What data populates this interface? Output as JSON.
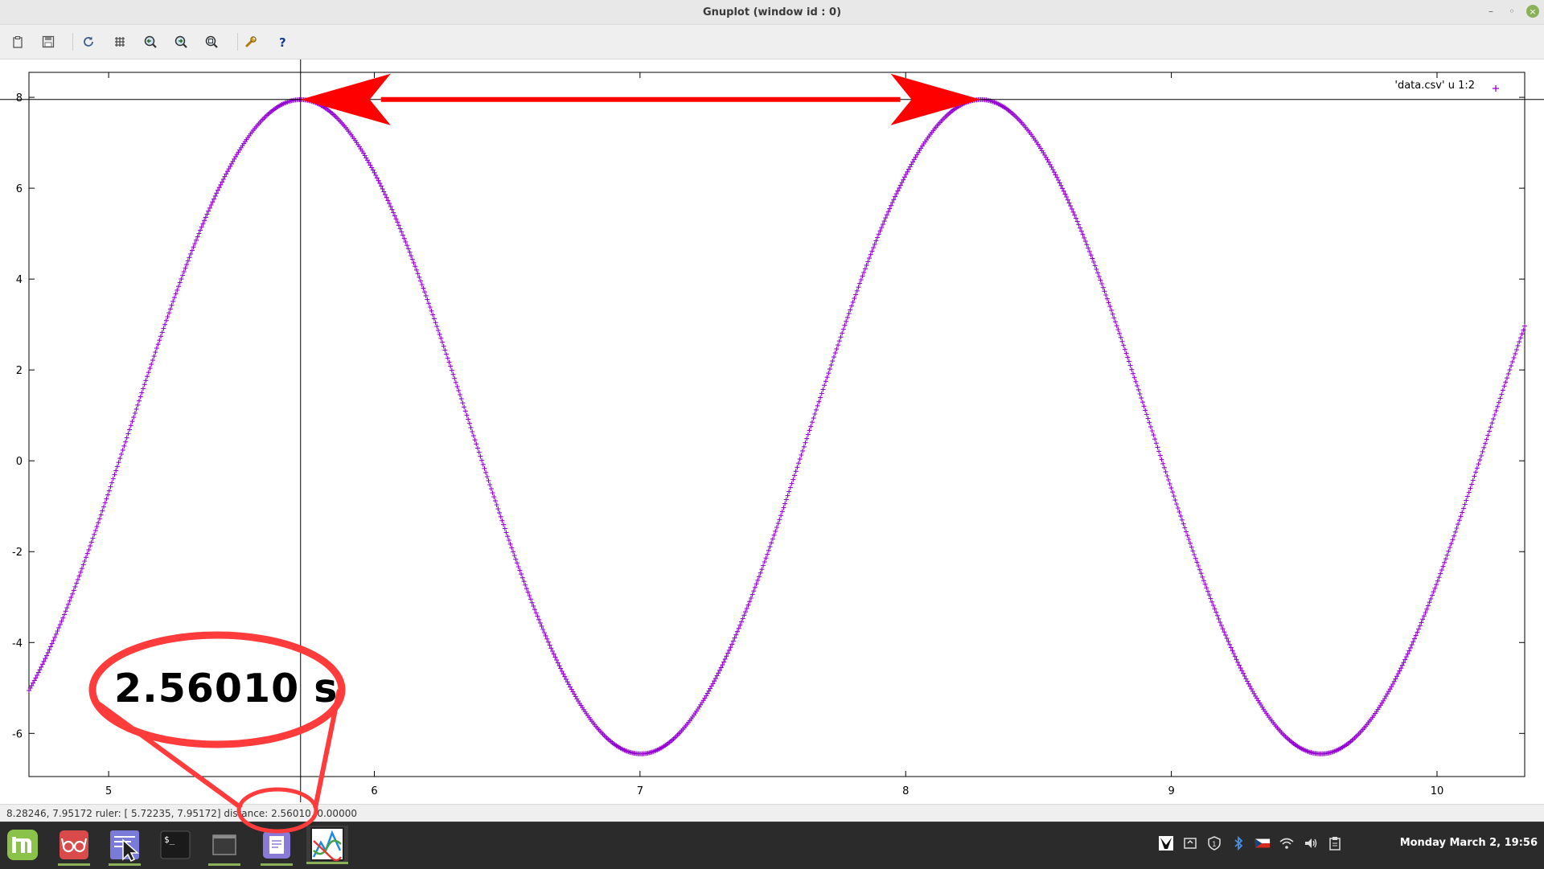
{
  "window": {
    "title": "Gnuplot (window id : 0)",
    "controls": [
      "minimize",
      "maximize",
      "close"
    ]
  },
  "toolbar": {
    "buttons": [
      {
        "name": "copy-clipboard",
        "icon": "clipboard-icon"
      },
      {
        "name": "export",
        "icon": "save-icon"
      },
      {
        "name": "replot",
        "icon": "refresh-icon"
      },
      {
        "name": "grid",
        "icon": "grid-icon"
      },
      {
        "name": "previous-zoom",
        "icon": "zoom-previous-icon"
      },
      {
        "name": "next-zoom",
        "icon": "zoom-next-icon"
      },
      {
        "name": "autoscale",
        "icon": "zoom-fit-icon"
      },
      {
        "name": "settings",
        "icon": "wrench-icon"
      },
      {
        "name": "help",
        "icon": "help-icon"
      }
    ]
  },
  "chart_data": {
    "type": "scatter",
    "title": "",
    "xlabel": "",
    "ylabel": "",
    "xlim": [
      4.7,
      10.33
    ],
    "ylim": [
      -6.95,
      8.55
    ],
    "xticks": [
      5,
      6,
      7,
      8,
      9,
      10
    ],
    "yticks": [
      -6,
      -4,
      -2,
      0,
      2,
      4,
      6,
      8
    ],
    "grid": false,
    "legend_position": "top-right",
    "series": [
      {
        "name": "'data.csv' u 1:2",
        "color": "#9400d3",
        "marker": "+",
        "function": "sine",
        "amplitude": 7.2,
        "offset": 0.75,
        "period": 2.5601,
        "peak_x": 5.72235,
        "samples": 1100
      }
    ],
    "crosshair": {
      "x": 5.72235,
      "y": 7.95172
    },
    "annotation_arrow": {
      "from": [
        5.72235,
        7.95172
      ],
      "to": [
        8.28246,
        7.95172
      ],
      "color": "#ff0000",
      "style": "double-headed"
    }
  },
  "statusbar": {
    "text": "8.28246,  7.95172  ruler: [ 5.72235,  7.95172]  distance:  2.56010,  0.00000"
  },
  "annotation": {
    "label": "2.56010 s",
    "color": "#ff0000"
  },
  "taskbar": {
    "apps": [
      {
        "name": "mint-menu",
        "icon": "mint-logo-icon"
      },
      {
        "name": "reading-app",
        "icon": "glasses-icon"
      },
      {
        "name": "pointer-app",
        "icon": "cursor-icon"
      },
      {
        "name": "terminal",
        "icon": "terminal-icon"
      },
      {
        "name": "window",
        "icon": "window-icon"
      },
      {
        "name": "notes",
        "icon": "note-icon"
      },
      {
        "name": "gnuplot",
        "icon": "gnuplot-icon"
      }
    ],
    "tray": [
      "app-tray-icon",
      "update-icon",
      "shield-icon",
      "bluetooth-icon",
      "keyboard-flag-icon",
      "wifi-icon",
      "volume-icon",
      "clipboard-tray-icon"
    ],
    "clock": "Monday March  2, 19:56"
  }
}
